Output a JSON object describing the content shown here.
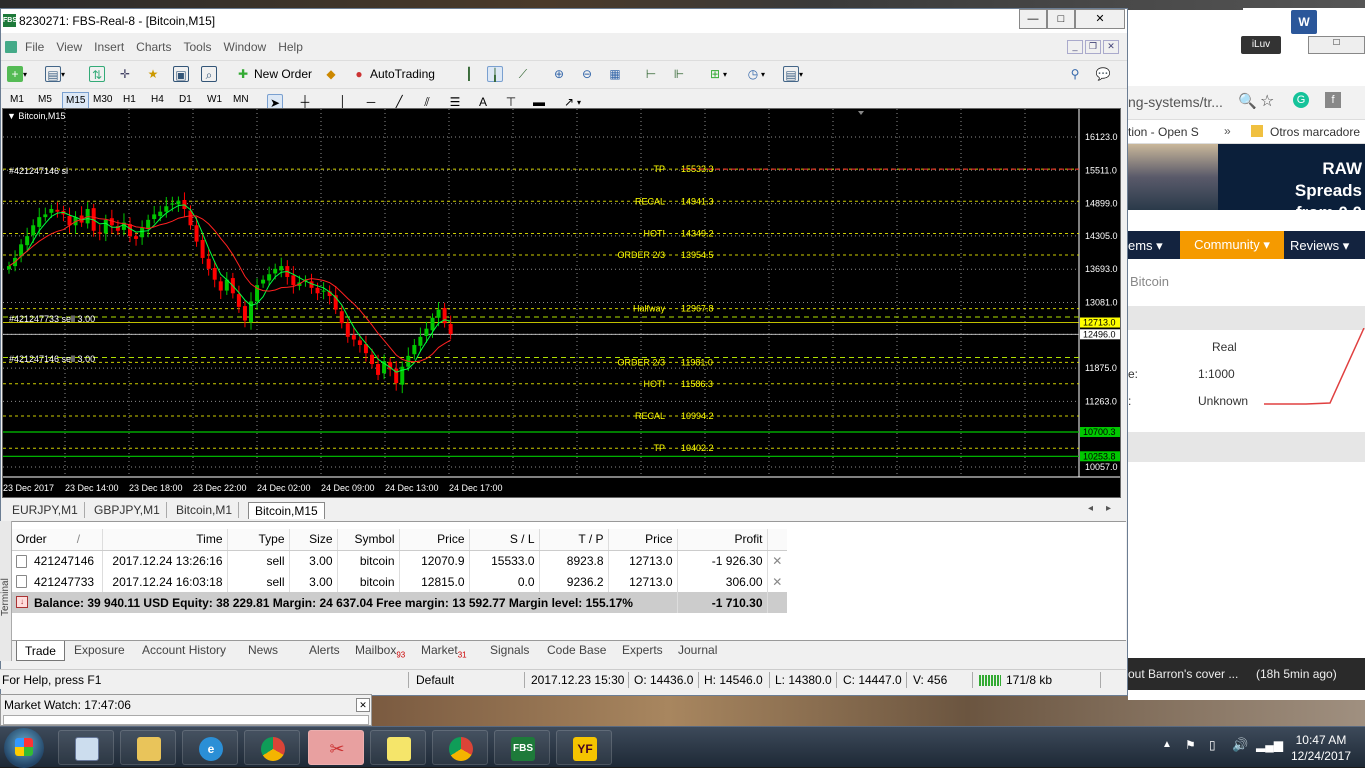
{
  "window": {
    "title": "8230271: FBS-Real-8 - [Bitcoin,M15]",
    "app_badge": "FBS",
    "min_label": "—",
    "max_label": "□",
    "close_label": "✕"
  },
  "menu": [
    "File",
    "View",
    "Insert",
    "Charts",
    "Tools",
    "Window",
    "Help"
  ],
  "toolbar": {
    "new_order": "New Order",
    "auto_trading": "AutoTrading"
  },
  "timeframes": [
    "M1",
    "M5",
    "M15",
    "M30",
    "H1",
    "H4",
    "D1",
    "W1",
    "MN"
  ],
  "active_timeframe": "M15",
  "chart": {
    "label": "Bitcoin,M15",
    "symbol_tag": "▼ Bitcoin,M15",
    "order_tags": [
      "#421247146 sl",
      "#421247733 sell 3.00",
      "#421247146 sell 3.00"
    ]
  },
  "chart_data": {
    "type": "candlestick",
    "ylim": [
      10057.0,
      16123.0
    ],
    "y_ticks": [
      16123.0,
      15511.0,
      14899.0,
      14305.0,
      13693.0,
      13081.0,
      12496.0,
      11875.0,
      11263.0,
      10057.0
    ],
    "y_tick_labels": [
      "16123.0",
      "15511.0",
      "14899.0",
      "14305.0",
      "13693.0",
      "13081.0",
      "12496.0",
      "11875.0",
      "11263.0",
      "10057.0"
    ],
    "x_tick_labels": [
      "23 Dec 2017",
      "23 Dec 14:00",
      "23 Dec 18:00",
      "23 Dec 22:00",
      "24 Dec 02:00",
      "24 Dec 09:00",
      "24 Dec 13:00",
      "24 Dec 17:00"
    ],
    "price_labels": [
      {
        "value": 12713.0,
        "text": "12713.0",
        "bg": "#ffff00"
      },
      {
        "value": 12496.0,
        "text": "12496.0",
        "bg": "#ffffff"
      },
      {
        "value": 10700.3,
        "text": "10700.3",
        "bg": "#00c800"
      },
      {
        "value": 10253.8,
        "text": "10253.8",
        "bg": "#00c800"
      }
    ],
    "levels": [
      {
        "name": "TP",
        "value": 15533.3,
        "text": "15533.3"
      },
      {
        "name": "RECAL",
        "value": 14941.3,
        "text": "14941.3"
      },
      {
        "name": "HOT!",
        "value": 14349.2,
        "text": "14349.2"
      },
      {
        "name": "ORDER 2/3",
        "value": 13954.5,
        "text": "13954.5"
      },
      {
        "name": "Halfway",
        "value": 12967.8,
        "text": "12967.8"
      },
      {
        "name": "ORDER 2/3",
        "value": 11981.0,
        "text": "11981.0"
      },
      {
        "name": "HOT!",
        "value": 11586.3,
        "text": "11586.3"
      },
      {
        "name": "RECAL",
        "value": 10994.2,
        "text": "10994.2"
      },
      {
        "name": "TP",
        "value": 10402.2,
        "text": "10402.2"
      }
    ],
    "close_path": [
      13750,
      13900,
      14150,
      14300,
      14500,
      14650,
      14700,
      14800,
      14750,
      14700,
      14500,
      14650,
      14550,
      14800,
      14400,
      14350,
      14600,
      14500,
      14400,
      14550,
      14300,
      14250,
      14450,
      14600,
      14700,
      14750,
      14850,
      14900,
      14950,
      14800,
      14500,
      14200,
      13900,
      13700,
      13500,
      13300,
      13500,
      13250,
      13000,
      12750,
      13100,
      13400,
      13500,
      13600,
      13700,
      13750,
      13550,
      13400,
      13450,
      13500,
      13350,
      13250,
      13300,
      13200,
      12950,
      12700,
      12450,
      12400,
      12300,
      12150,
      11950,
      11750,
      12000,
      11850,
      11600,
      11900,
      12100,
      12300,
      12450,
      12600,
      12800,
      12950,
      12700,
      12500
    ]
  },
  "chart_tabs": [
    "EURJPY,M1",
    "GBPJPY,M1",
    "Bitcoin,M1",
    "Bitcoin,M15"
  ],
  "active_chart_tab": "Bitcoin,M15",
  "orders": {
    "headers": [
      "Order",
      "Time",
      "Type",
      "Size",
      "Symbol",
      "Price",
      "S / L",
      "T / P",
      "Price",
      "Profit"
    ],
    "sort_marker": "/",
    "rows": [
      [
        "421247146",
        "2017.12.24 13:26:16",
        "sell",
        "3.00",
        "bitcoin",
        "12070.9",
        "15533.0",
        "8923.8",
        "12713.0",
        "-1 926.30"
      ],
      [
        "421247733",
        "2017.12.24 16:03:18",
        "sell",
        "3.00",
        "bitcoin",
        "12815.0",
        "0.0",
        "9236.2",
        "12713.0",
        "306.00"
      ]
    ],
    "balance_line": "Balance: 39 940.11 USD  Equity: 38 229.81  Margin: 24 637.04  Free margin: 13 592.77  Margin level: 155.17%",
    "balance_profit": "-1 710.30"
  },
  "terminal": {
    "side_label": "Terminal",
    "tabs": [
      {
        "label": "Trade",
        "badge": ""
      },
      {
        "label": "Exposure",
        "badge": ""
      },
      {
        "label": "Account History",
        "badge": ""
      },
      {
        "label": "News",
        "badge": ""
      },
      {
        "label": "Alerts",
        "badge": ""
      },
      {
        "label": "Mailbox",
        "badge": "93"
      },
      {
        "label": "Market",
        "badge": "31"
      },
      {
        "label": "Signals",
        "badge": ""
      },
      {
        "label": "Code Base",
        "badge": ""
      },
      {
        "label": "Experts",
        "badge": ""
      },
      {
        "label": "Journal",
        "badge": ""
      }
    ],
    "active_tab": "Trade"
  },
  "status": {
    "help": "For Help, press F1",
    "profile": "Default",
    "datetime": "2017.12.23 15:30",
    "open": "O: 14436.0",
    "high": "H: 14546.0",
    "low": "L: 14380.0",
    "close": "C: 14447.0",
    "volume": "V: 456",
    "traffic": "171/8 kb"
  },
  "market_watch": {
    "title": "Market Watch: 17:47:06",
    "close": "✕"
  },
  "browser": {
    "url_fragment": "ng-systems/tr...",
    "bookmark1": "tion - Open S",
    "bookmark2": "Otros marcadore",
    "banner": "RAW Spreads\nfrom 0.0 Pips",
    "banner_line1": "RAW Spreads",
    "banner_line2": "from 0.0 Pips",
    "nav_items": "ems ▾",
    "nav_community": "Community ▾",
    "nav_reviews": "Reviews ▾",
    "breadcrumb": "Bitcoin",
    "info_type": "Real",
    "info_leverage_label": "e:",
    "info_leverage": "1:1000",
    "info_status_label": ":",
    "info_status": "Unknown",
    "news": "out Barron's cover ...",
    "news_time": "(18h 5min ago)",
    "iluv": "iLuv"
  },
  "taskbar": {
    "time": "10:47 AM",
    "date": "12/24/2017",
    "fbs": "FBS",
    "yf": "YF"
  },
  "colors": {
    "chart_bg": "#000000",
    "bull_candle": "#00c800",
    "bear_candle": "#ff0000",
    "level_color": "#ffff00",
    "accent_orange": "#f59a00"
  }
}
